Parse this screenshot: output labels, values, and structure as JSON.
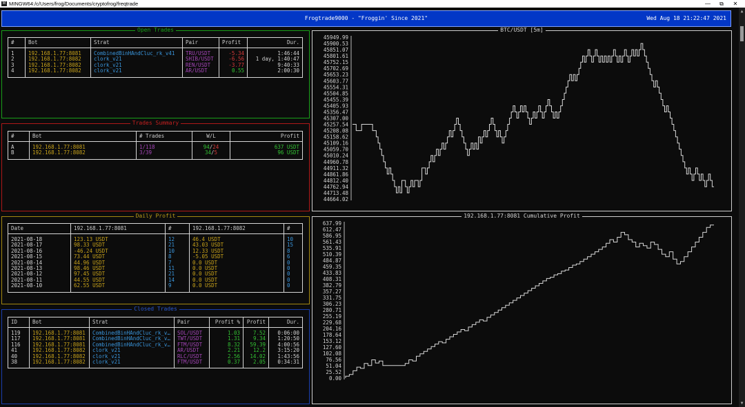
{
  "window": {
    "title": "MINGW64:/c/Users/frog/Documents/cryptofrog/freqtrade",
    "icon": "mingw-icon",
    "min_glyph": "—",
    "max_glyph": "⧉",
    "close_glyph": "✕"
  },
  "header": {
    "title": "Frogtrade9000 - \"Froggin' Since 2021\"",
    "datetime": "Wed Aug 18 21:22:47 2021"
  },
  "colors": {
    "header_bg": "#0337c6",
    "green": "#33c333",
    "red": "#d83a3a",
    "yellow": "#c8a21a",
    "blue": "#3a96dd",
    "magenta": "#a545b8"
  },
  "open_trades": {
    "title": "Open Trades",
    "headers": [
      "#",
      "Bot",
      "Strat",
      "Pair",
      "Profit",
      "Dur."
    ],
    "rows": [
      {
        "id": "1",
        "bot": "192.168.1.77:8081",
        "strat": "CombinedBinHAndCluc_rk_v41",
        "pair": "TRU/USDT",
        "profit": "-5.34",
        "dur": "1:46:44",
        "positive": false
      },
      {
        "id": "2",
        "bot": "192.168.1.77:8082",
        "strat": "clork_v21",
        "pair": "SHIB/USDT",
        "profit": "-6.56",
        "dur": "1 day, 1:40:47",
        "positive": false
      },
      {
        "id": "3",
        "bot": "192.168.1.77:8082",
        "strat": "clork_v21",
        "pair": "REN/USDT",
        "profit": "-3.77",
        "dur": "9:40:33",
        "positive": false
      },
      {
        "id": "4",
        "bot": "192.168.1.77:8082",
        "strat": "clork_v21",
        "pair": "AR/USDT",
        "profit": "0.55",
        "dur": "2:00:30",
        "positive": true
      }
    ]
  },
  "trades_summary": {
    "title": "Trades Summary",
    "headers": [
      "#",
      "Bot",
      "# Trades",
      "W/L",
      "Profit"
    ],
    "rows": [
      {
        "id": "A",
        "bot": "192.168.1.77:8081",
        "trades": "1/118",
        "wins": "94",
        "losses": "24",
        "profit": "637 USDT"
      },
      {
        "id": "B",
        "bot": "192.168.1.77:8082",
        "trades": "3/39",
        "wins": "34",
        "losses": "5",
        "profit": "96 USDT"
      }
    ]
  },
  "daily_profit": {
    "title": "Daily Profit",
    "headers": [
      "Date",
      "192.168.1.77:8081",
      "#",
      "192.168.1.77:8082",
      "#"
    ],
    "rows": [
      {
        "date": "2021-08-18",
        "p1": "123.13 USDT",
        "n1": "12",
        "p2": "46.4 USDT",
        "n2": "10"
      },
      {
        "date": "2021-08-17",
        "p1": "98.33 USDT",
        "n1": "21",
        "p2": "43.03 USDT",
        "n2": "15"
      },
      {
        "date": "2021-08-16",
        "p1": "-46.24 USDT",
        "n1": "10",
        "p2": "12.33 USDT",
        "n2": "8"
      },
      {
        "date": "2021-08-15",
        "p1": "73.44 USDT",
        "n1": "8",
        "p2": "-5.05 USDT",
        "n2": "6"
      },
      {
        "date": "2021-08-14",
        "p1": "44.96 USDT",
        "n1": "7",
        "p2": "0.0 USDT",
        "n2": "0"
      },
      {
        "date": "2021-08-13",
        "p1": "98.46 USDT",
        "n1": "11",
        "p2": "0.0 USDT",
        "n2": "0"
      },
      {
        "date": "2021-08-12",
        "p1": "97.45 USDT",
        "n1": "21",
        "p2": "0.0 USDT",
        "n2": "0"
      },
      {
        "date": "2021-08-11",
        "p1": "44.55 USDT",
        "n1": "14",
        "p2": "0.0 USDT",
        "n2": "0"
      },
      {
        "date": "2021-08-10",
        "p1": "62.55 USDT",
        "n1": "9",
        "p2": "0.0 USDT",
        "n2": "0"
      }
    ]
  },
  "closed_trades": {
    "title": "Closed Trades",
    "headers": [
      "ID",
      "Bot",
      "Strat",
      "Pair",
      "Profit %",
      "Profit",
      "Dur."
    ],
    "rows": [
      {
        "id": "119",
        "bot": "192.168.1.77:8081",
        "strat": "CombinedBinHAndCluc_rk_v…",
        "pair": "SOL/USDT",
        "pct": "1.03",
        "profit": "7.52",
        "dur": "0:06:00"
      },
      {
        "id": "117",
        "bot": "192.168.1.77:8081",
        "strat": "CombinedBinHAndCluc_rk_v…",
        "pair": "TWT/USDT",
        "pct": "1.31",
        "profit": "9.34",
        "dur": "1:20:50"
      },
      {
        "id": "116",
        "bot": "192.168.1.77:8081",
        "strat": "CombinedBinHAndCluc_rk_v…",
        "pair": "FTM/USDT",
        "pct": "8.32",
        "profit": "59.39",
        "dur": "4:00:56"
      },
      {
        "id": "41",
        "bot": "192.168.1.77:8082",
        "strat": "clork_v21",
        "pair": "AR/USDT",
        "pct": "2.21",
        "profit": "12.2",
        "dur": "3:15:20"
      },
      {
        "id": "40",
        "bot": "192.168.1.77:8082",
        "strat": "clork_v21",
        "pair": "RLC/USDT",
        "pct": "2.56",
        "profit": "14.02",
        "dur": "1:43:56"
      },
      {
        "id": "38",
        "bot": "192.168.1.77:8082",
        "strat": "clork_v21",
        "pair": "FTM/USDT",
        "pct": "0.37",
        "profit": "2.05",
        "dur": "0:34:31"
      }
    ]
  },
  "chart_data": [
    {
      "type": "line",
      "title": "BTC/USDT [5m]",
      "xlabel": "",
      "ylabel": "",
      "ylim": [
        44664.02,
        45949.99
      ],
      "yticks": [
        "45949.99",
        "45900.53",
        "45851.07",
        "45801.61",
        "45752.15",
        "45702.69",
        "45653.23",
        "45603.77",
        "45554.31",
        "45504.85",
        "45455.39",
        "45405.93",
        "45356.47",
        "45307.00",
        "45257.54",
        "45208.08",
        "45158.62",
        "45109.16",
        "45059.70",
        "45010.24",
        "44960.78",
        "44911.32",
        "44861.86",
        "44812.40",
        "44762.94",
        "44713.48",
        "44664.02"
      ],
      "series": [
        {
          "values": [
            45258,
            45258,
            45258,
            45208,
            45208,
            45208,
            45258,
            45258,
            45258,
            45258,
            45258,
            45258,
            45208,
            45208,
            45158,
            45109,
            45060,
            45010,
            44960,
            44911,
            44862,
            44911,
            44862,
            44812,
            44762,
            44713,
            44762,
            44713,
            44812,
            44812,
            44762,
            44713,
            44762,
            44812,
            44762,
            44812,
            44812,
            44762,
            44812,
            44911,
            44911,
            44862,
            44911,
            44960,
            45010,
            44960,
            45010,
            45060,
            45010,
            45060,
            45109,
            45060,
            45109,
            45158,
            45208,
            45158,
            45208,
            45258,
            45307,
            45258,
            45208,
            45158,
            45109,
            45060,
            45010,
            45060,
            45109,
            45060,
            45109,
            45060,
            45158,
            45109,
            45158,
            45208,
            45158,
            45208,
            45258,
            45307,
            45258,
            45208,
            45158,
            45208,
            45158,
            45109,
            45158,
            45208,
            45258,
            45307,
            45356,
            45405,
            45356,
            45307,
            45356,
            45405,
            45356,
            45405,
            45356,
            45307,
            45258,
            45307,
            45356,
            45307,
            45356,
            45405,
            45356,
            45307,
            45356,
            45405,
            45455,
            45405,
            45356,
            45307,
            45356,
            45307,
            45356,
            45405,
            45455,
            45505,
            45554,
            45604,
            45653,
            45604,
            45653,
            45604,
            45653,
            45702,
            45752,
            45801,
            45752,
            45801,
            45851,
            45801,
            45752,
            45801,
            45851,
            45801,
            45752,
            45801,
            45752,
            45801,
            45752,
            45801,
            45752,
            45801,
            45851,
            45801,
            45752,
            45801,
            45752,
            45801,
            45851,
            45801,
            45752,
            45801,
            45851,
            45801,
            45851,
            45801,
            45851,
            45900,
            45851,
            45801,
            45752,
            45702,
            45653,
            45604,
            45554,
            45604,
            45554,
            45505,
            45455,
            45405,
            45356,
            45405,
            45356,
            45307,
            45258,
            45208,
            45158,
            45109,
            45060,
            45010,
            44960,
            44911,
            44862,
            44911,
            44862,
            44812,
            44862,
            44911,
            44862,
            44812,
            44862,
            44812,
            44762,
            44812,
            44862,
            44812,
            44762
          ]
        }
      ]
    },
    {
      "type": "line",
      "title": "192.168.1.77:8081 Cumulative Profit",
      "xlabel": "",
      "ylabel": "",
      "ylim": [
        0.0,
        637.99
      ],
      "yticks": [
        "637.99",
        "612.47",
        "586.95",
        "561.43",
        "535.91",
        "510.39",
        "484.87",
        "459.35",
        "433.83",
        "408.31",
        "382.79",
        "357.27",
        "331.75",
        "306.23",
        "280.71",
        "255.19",
        "229.68",
        "204.16",
        "178.64",
        "153.12",
        "127.60",
        "102.08",
        "76.56",
        "51.04",
        "25.52",
        "0.00"
      ],
      "series": [
        {
          "values": [
            0,
            8,
            15,
            30,
            45,
            40,
            60,
            52,
            75,
            62,
            70,
            52,
            52,
            52,
            52,
            52,
            52,
            60,
            75,
            70,
            90,
            100,
            110,
            120,
            130,
            140,
            150,
            145,
            160,
            170,
            180,
            190,
            200,
            195,
            210,
            220,
            230,
            240,
            235,
            250,
            260,
            270,
            280,
            290,
            300,
            310,
            320,
            330,
            340,
            350,
            360,
            370,
            380,
            390,
            400,
            410,
            415,
            425,
            430,
            440,
            445,
            455,
            465,
            470,
            480,
            490,
            500,
            510,
            520,
            530,
            540,
            555,
            570,
            560,
            580,
            600,
            590,
            570,
            560,
            540,
            555,
            545,
            535,
            560,
            550,
            530,
            510,
            500,
            520,
            490,
            470,
            480,
            500,
            520,
            540,
            560,
            580,
            600,
            620,
            630
          ]
        }
      ]
    }
  ]
}
